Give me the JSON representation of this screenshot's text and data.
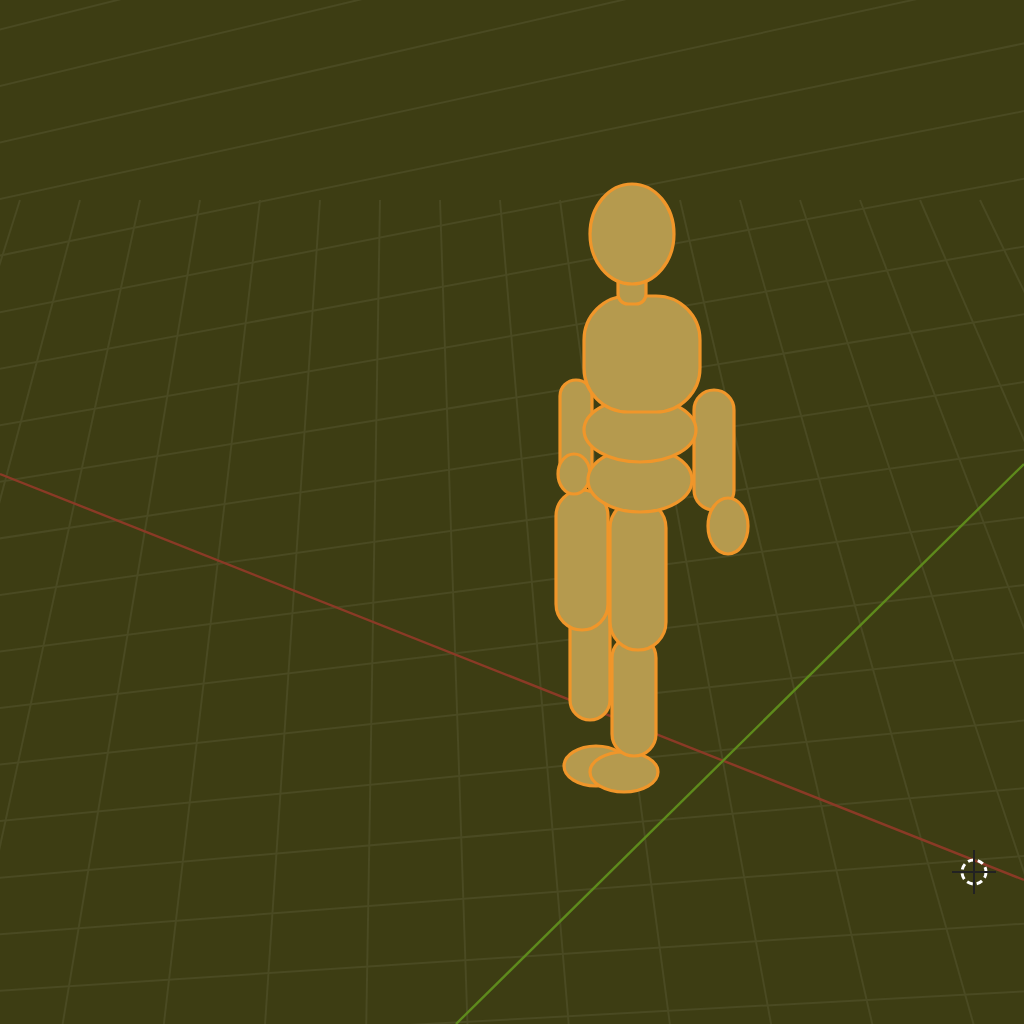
{
  "viewport": {
    "figure_selected": true
  }
}
